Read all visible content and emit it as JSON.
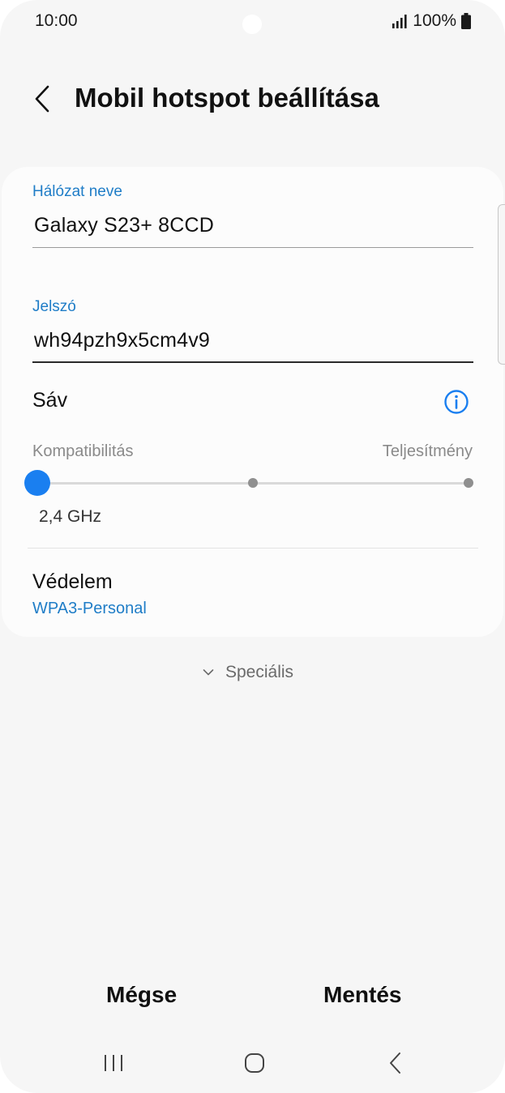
{
  "status_bar": {
    "time": "10:00",
    "battery": "100%",
    "icons": [
      "signal-icon",
      "battery-icon"
    ]
  },
  "header": {
    "title": "Mobil hotspot beállítása",
    "back_icon": "back-arrow-icon"
  },
  "form": {
    "network_name_label": "Hálózat neve",
    "network_name_value": "Galaxy S23+ 8CCD",
    "password_label": "Jelszó",
    "password_value": "wh94pzh9x5cm4v9",
    "band_label": "Sáv",
    "band_info_icon": "info-icon",
    "band_slider": {
      "left_label": "Kompatibilitás",
      "right_label": "Teljesítmény",
      "steps": 3,
      "selected_step": 0,
      "selected_value": "2,4 GHz"
    },
    "security_label": "Védelem",
    "security_value": "WPA3-Personal"
  },
  "advanced": {
    "label": "Speciális",
    "icon": "chevron-down-icon"
  },
  "actions": {
    "cancel_label": "Mégse",
    "save_label": "Mentés"
  },
  "nav_bar": {
    "icons": [
      "recent-apps-icon",
      "home-icon",
      "back-icon"
    ]
  },
  "colors": {
    "accent": "#1a7ff0",
    "label_blue": "#1f7dc7",
    "background": "#f6f6f6",
    "card": "#fcfcfc"
  }
}
